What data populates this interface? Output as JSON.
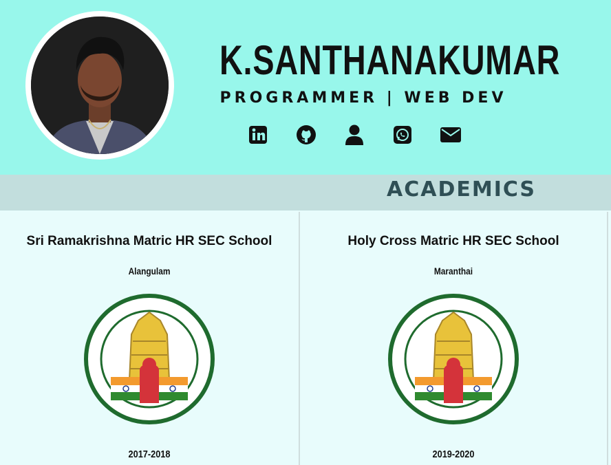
{
  "profile": {
    "name": "K.SANTHANAKUMAR",
    "role": "PROGRAMMER | WEB DEV"
  },
  "social_icons": [
    "linkedin-icon",
    "github-icon",
    "user-icon",
    "whatsapp-icon",
    "mail-icon"
  ],
  "section": {
    "title": "ACADEMICS"
  },
  "academics": [
    {
      "school": "Sri Ramakrishna Matric HR SEC School",
      "place": "Alangulam",
      "years": "2017-2018"
    },
    {
      "school": "Holy Cross Matric HR SEC School",
      "place": "Maranthai",
      "years": "2019-2020"
    }
  ],
  "colors": {
    "header_bg": "#98f7eb",
    "band_bg": "#c2dedd",
    "section_title": "#2f4f55",
    "body_bg": "#e8fcfc"
  }
}
